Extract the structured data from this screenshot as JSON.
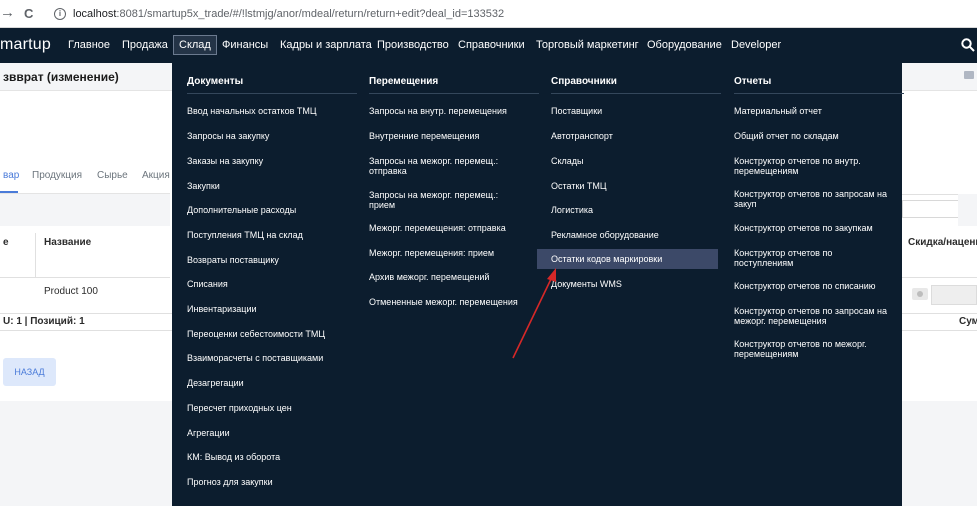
{
  "browser": {
    "back_glyph": "→",
    "reload_glyph": "C",
    "url_host": "localhost",
    "url_path": ":8081/smartup5x_trade/#/!lstmjg/anor/mdeal/return/return+edit?deal_id=133532"
  },
  "topnav": {
    "brand": "martup",
    "items": [
      "Главное",
      "Продажа",
      "Склад",
      "Финансы",
      "Кадры и зарплата",
      "Производство",
      "Справочники",
      "Торговый маркетинг",
      "Оборудование",
      "Developer"
    ],
    "active_item": "Склад"
  },
  "page": {
    "title": "звврат (изменение)",
    "tabs": [
      "вар",
      "Продукция",
      "Сырье",
      "Акция"
    ],
    "table": {
      "col_icon": "е",
      "col_name": "Название",
      "col_discount": "Скидка/наценк",
      "row_name": "Product 100"
    },
    "summary": "U: 1 | Позиций: 1",
    "summary_right": "Сум",
    "back_button": "НАЗАД"
  },
  "mega_menu": {
    "columns": [
      {
        "header": "Документы",
        "items": [
          "Ввод начальных остатков ТМЦ",
          "Запросы на закупку",
          "Заказы на закупку",
          "Закупки",
          "Дополнительные расходы",
          "Поступления ТМЦ на склад",
          "Возвраты поставщику",
          "Списания",
          "Инвентаризации",
          "Переоценки себестоимости ТМЦ",
          "Взаиморасчеты с поставщиками",
          "Дезагрегации",
          "Пересчет приходных цен",
          "Агрегации",
          "КМ: Вывод из оборота",
          "Прогноз для закупки"
        ]
      },
      {
        "header": "Перемещения",
        "items": [
          "Запросы на внутр. перемещения",
          "Внутренние перемещения",
          "Запросы на межорг. перемещ.: отправка",
          "Запросы на межорг. перемещ.: прием",
          "Межорг. перемещения: отправка",
          "Межорг. перемещения: прием",
          "Архив межорг. перемещений",
          "Отмененные межорг. перемещения"
        ]
      },
      {
        "header": "Справочники",
        "items": [
          "Поставщики",
          "Автотранспорт",
          "Склады",
          "Остатки ТМЦ",
          "Логистика",
          "Рекламное оборудование",
          "Остатки кодов маркировки",
          "Документы WMS"
        ],
        "highlighted": "Остатки кодов маркировки"
      },
      {
        "header": "Отчеты",
        "items": [
          "Материальный отчет",
          "Общий отчет по складам",
          "Конструктор отчетов по внутр. перемещениям",
          "Конструктор отчетов по запросам на закуп",
          "Конструктор отчетов по закупкам",
          "Конструктор отчетов по поступлениям",
          "Конструктор отчетов по списанию",
          "Конструктор отчетов по запросам на межорг. перемещения",
          "Конструктор отчетов по межорг. перемещениям"
        ]
      }
    ]
  },
  "colors": {
    "nav_bg": "#0c1d2e",
    "highlight_bg": "#3c4968",
    "annotation_arrow": "#d62828",
    "accent": "#4a7bd9"
  }
}
